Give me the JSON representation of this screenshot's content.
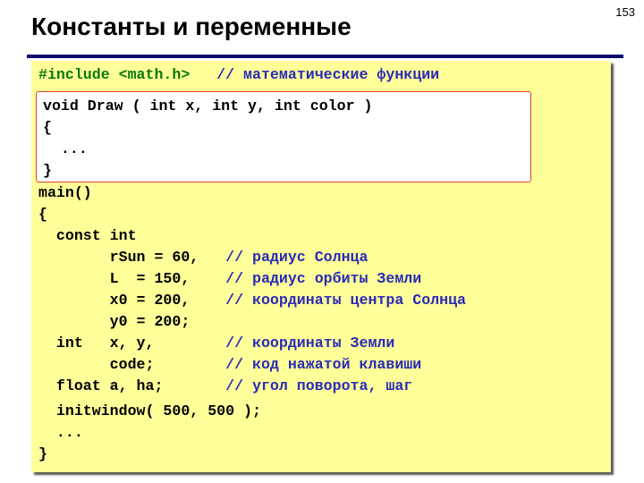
{
  "page_number": "153",
  "title": "Константы и переменные",
  "include_line": {
    "code": "#include <math.h>   ",
    "comment": "// математические функции"
  },
  "function_block": [
    "void Draw ( int x, int y, int color )",
    "{",
    "  ...",
    "}"
  ],
  "main_block": [
    {
      "code": "main()",
      "comment": ""
    },
    {
      "code": "{",
      "comment": ""
    },
    {
      "code": "  const int",
      "comment": ""
    },
    {
      "code": "        rSun = 60,   ",
      "comment": "// радиус Солнца"
    },
    {
      "code": "        L  = 150,    ",
      "comment": "// радиус орбиты Земли"
    },
    {
      "code": "        x0 = 200,    ",
      "comment": "// координаты центра Солнца"
    },
    {
      "code": "        y0 = 200;",
      "comment": ""
    },
    {
      "code": "  int   x, y,        ",
      "comment": "// координаты Земли"
    },
    {
      "code": "        code;        ",
      "comment": "// код нажатой клавиши"
    },
    {
      "code": "  float a, ha;       ",
      "comment": "// угол поворота, шаг"
    },
    {
      "code": "  initwindow( 500, 500 );",
      "comment": ""
    },
    {
      "code": "  ...",
      "comment": ""
    },
    {
      "code": "}",
      "comment": ""
    }
  ],
  "colors": {
    "background": "#ffff99",
    "comment": "#2a2ab8",
    "preprocessor": "#0a7a0a",
    "highlight_border": "#e0402a",
    "title_rule": "#0a0a6e"
  }
}
